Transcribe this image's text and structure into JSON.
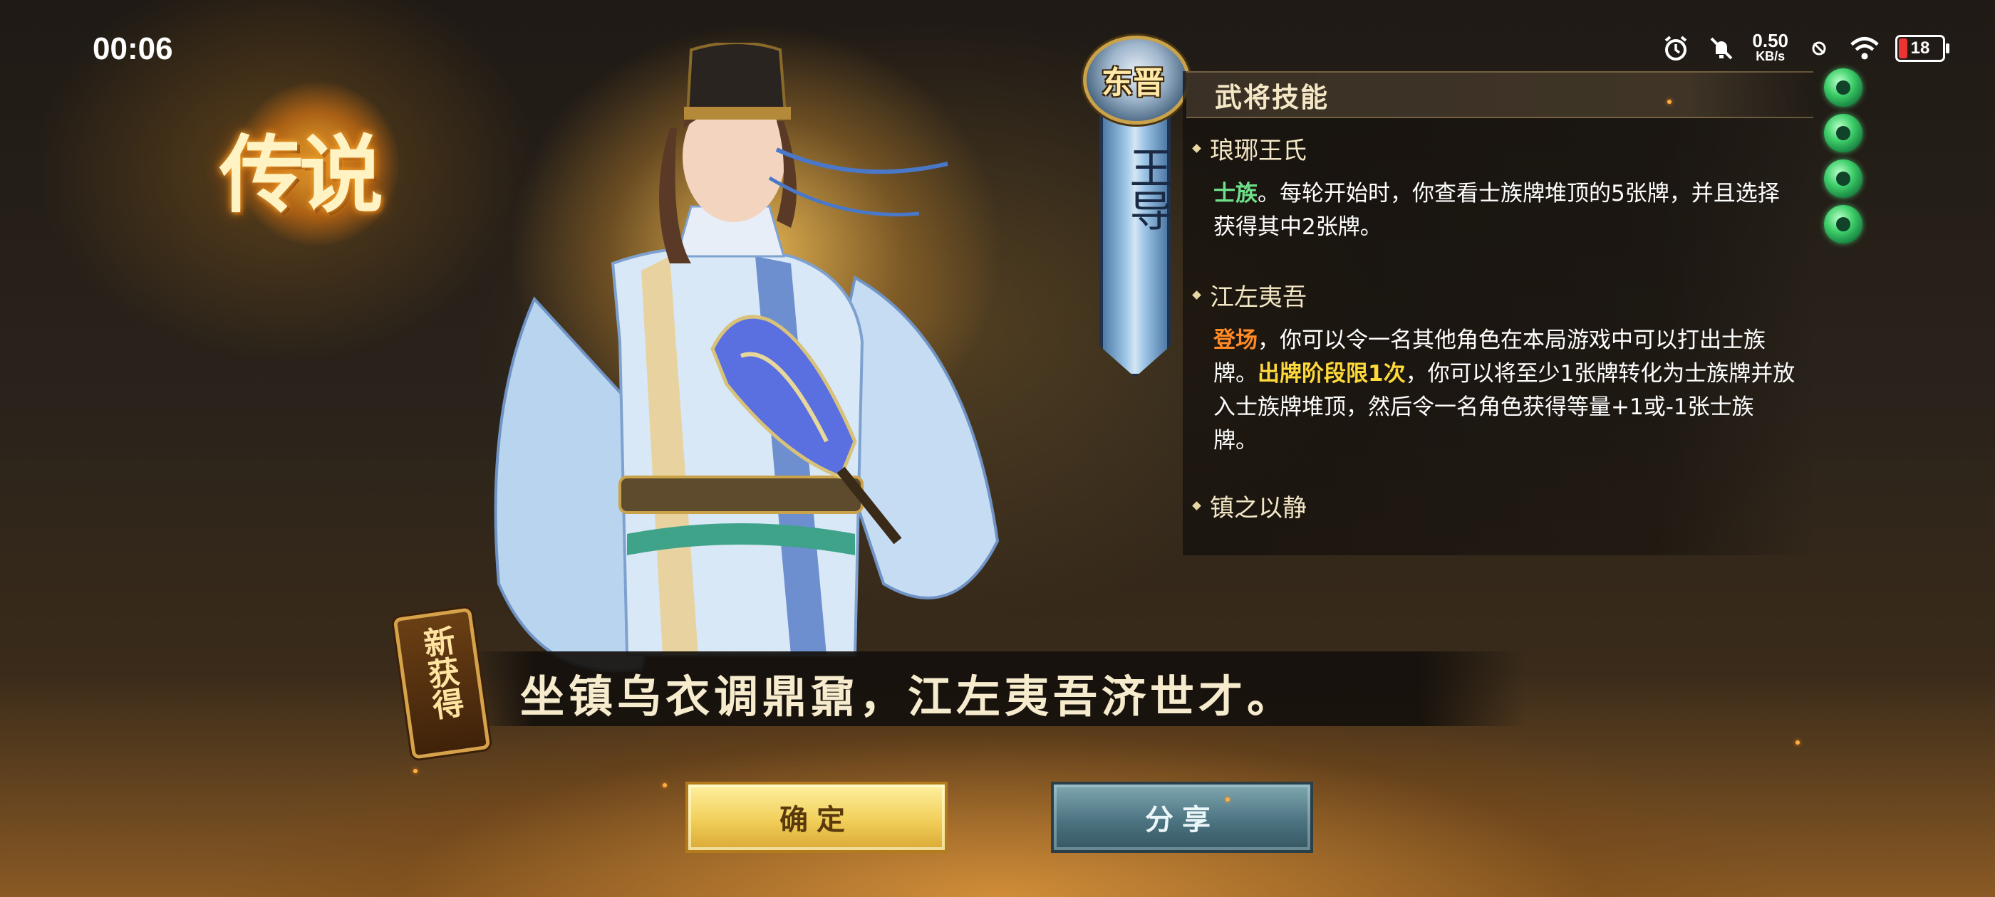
{
  "status_bar": {
    "time": "00:06",
    "net_speed_value": "0.50",
    "net_speed_unit": "KB/s",
    "battery": "18",
    "icons": [
      "alarm-icon",
      "mute-icon",
      "vpn-off-icon",
      "wifi-icon",
      "battery-icon"
    ]
  },
  "rarity": {
    "label": "传说"
  },
  "kingdom": {
    "label": "东晋"
  },
  "hero": {
    "name": "王导"
  },
  "skills": {
    "title": "武将技能",
    "items": [
      {
        "name": "琅琊王氏",
        "tag": "士族",
        "desc": "。每轮开始时，你查看士族牌堆顶的5张牌，并且选择获得其中2张牌。"
      },
      {
        "name": "江左夷吾",
        "tag": "登场",
        "desc_a": "，你可以令一名其他角色在本局游戏中可以打出士族牌。",
        "tag2": "出牌阶段限1次",
        "desc_b": "，你可以将至少1张牌转化为士族牌并放入士族牌堆顶，然后令一名角色获得等量+1或-1张士族牌。"
      },
      {
        "name": "镇之以静"
      }
    ]
  },
  "jade_count": 4,
  "badge": {
    "label": "新获得"
  },
  "quote": "坐镇乌衣调鼎鼐，江左夷吾济世才。",
  "buttons": {
    "confirm": "确定",
    "share": "分享"
  },
  "colors": {
    "keyword_green": "#6fe08a",
    "keyword_orange": "#ff8a26",
    "keyword_yellow": "#ffd93a",
    "confirm_gold": "#f1cf5a",
    "share_teal": "#4d7481"
  }
}
